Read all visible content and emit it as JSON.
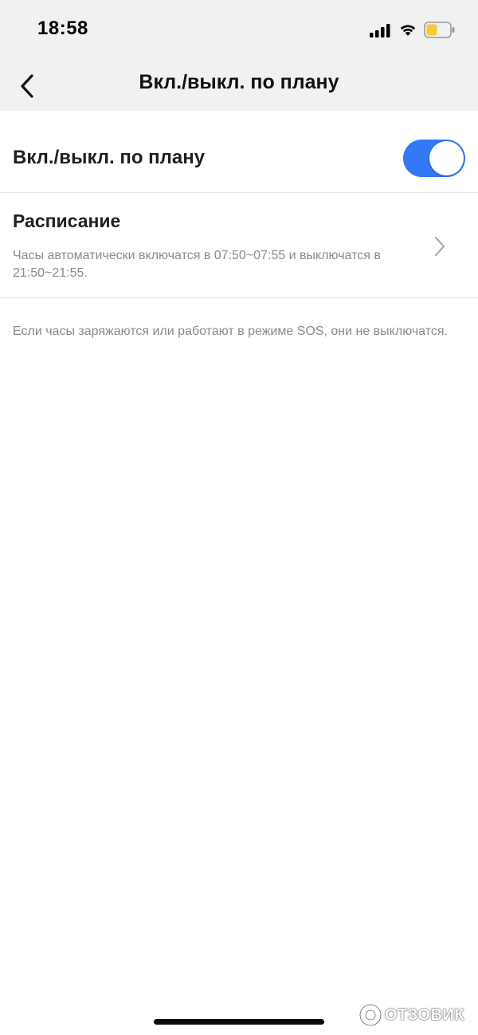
{
  "status_bar": {
    "time": "18:58",
    "signal_icon": "cellular-signal-icon",
    "wifi_icon": "wifi-icon",
    "battery_icon": "battery-low-icon",
    "battery_color": "#f5c938"
  },
  "header": {
    "title": "Вкл./выкл. по плану",
    "back_icon": "chevron-left-icon",
    "background": "#f1f1f1"
  },
  "toggle_row": {
    "label": "Вкл./выкл. по плану",
    "enabled": true,
    "accent_color": "#3478f6"
  },
  "schedule_row": {
    "title": "Расписание",
    "description": "Часы автоматически включатся в 07:50~07:55 и выключатся в 21:50~21:55.",
    "chevron_icon": "chevron-right-icon"
  },
  "note": "Если часы заряжаются или работают в режиме SOS, они не выключатся.",
  "watermark": {
    "text": "ОТЗОВИК"
  }
}
